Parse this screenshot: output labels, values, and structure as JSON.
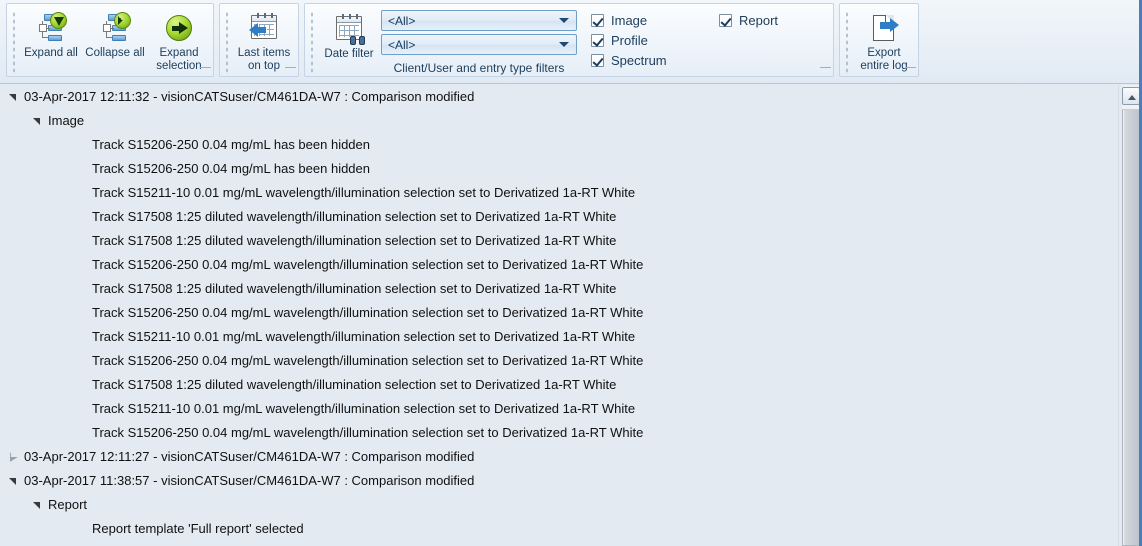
{
  "ribbon": {
    "groups": [
      {
        "name": "expand-collapse",
        "buttons": [
          {
            "label_line1": "Expand all",
            "label_line2": "",
            "icon": "expand-all-icon"
          },
          {
            "label_line1": "Collapse all",
            "label_line2": "",
            "icon": "collapse-all-icon"
          },
          {
            "label_line1": "Expand",
            "label_line2": "selection",
            "icon": "expand-selection-icon"
          }
        ]
      },
      {
        "name": "sorting",
        "buttons": [
          {
            "label_line1": "Last items",
            "label_line2": "on top",
            "icon": "last-items-on-top-icon"
          }
        ]
      },
      {
        "name": "date-filter",
        "buttons": [
          {
            "label_line1": "Date filter",
            "label_line2": "",
            "icon": "date-filter-icon"
          }
        ]
      }
    ],
    "filters": {
      "caption": "Client/User and entry type filters",
      "client_combo": {
        "value": "<All>",
        "arrow": "chevron-down-icon"
      },
      "user_combo": {
        "value": "<All>",
        "arrow": "chevron-down-icon"
      }
    },
    "entry_types": {
      "column1": [
        {
          "label": "Image",
          "checked": true
        },
        {
          "label": "Profile",
          "checked": true
        },
        {
          "label": "Spectrum",
          "checked": true
        }
      ],
      "column2": [
        {
          "label": "Report",
          "checked": true
        }
      ]
    },
    "export": {
      "label_line1": "Export",
      "label_line2": "entire log",
      "icon": "export-entire-log-icon"
    }
  },
  "tree": {
    "rows": [
      {
        "level": 0,
        "state": "expanded",
        "text": "03-Apr-2017 12:11:32 - visionCATSuser/CM461DA-W7 : Comparison modified"
      },
      {
        "level": 1,
        "state": "expanded",
        "text": "Image"
      },
      {
        "level": 2,
        "state": "leaf",
        "text": "Track S15206-250 0.04 mg/mL has been hidden"
      },
      {
        "level": 2,
        "state": "leaf",
        "text": "Track S15206-250 0.04 mg/mL has been hidden"
      },
      {
        "level": 2,
        "state": "leaf",
        "text": "Track S15211-10 0.01 mg/mL wavelength/illumination selection set to Derivatized 1a-RT White"
      },
      {
        "level": 2,
        "state": "leaf",
        "text": "Track S17508 1:25 diluted wavelength/illumination selection set to Derivatized 1a-RT White"
      },
      {
        "level": 2,
        "state": "leaf",
        "text": "Track S17508 1:25 diluted wavelength/illumination selection set to Derivatized 1a-RT White"
      },
      {
        "level": 2,
        "state": "leaf",
        "text": "Track S15206-250 0.04 mg/mL wavelength/illumination selection set to Derivatized 1a-RT White"
      },
      {
        "level": 2,
        "state": "leaf",
        "text": "Track S17508 1:25 diluted wavelength/illumination selection set to Derivatized 1a-RT White"
      },
      {
        "level": 2,
        "state": "leaf",
        "text": "Track S15206-250 0.04 mg/mL wavelength/illumination selection set to Derivatized 1a-RT White"
      },
      {
        "level": 2,
        "state": "leaf",
        "text": "Track S15211-10 0.01 mg/mL wavelength/illumination selection set to Derivatized 1a-RT White"
      },
      {
        "level": 2,
        "state": "leaf",
        "text": "Track S15206-250 0.04 mg/mL wavelength/illumination selection set to Derivatized 1a-RT White"
      },
      {
        "level": 2,
        "state": "leaf",
        "text": "Track S17508 1:25 diluted wavelength/illumination selection set to Derivatized 1a-RT White"
      },
      {
        "level": 2,
        "state": "leaf",
        "text": "Track S15211-10 0.01 mg/mL wavelength/illumination selection set to Derivatized 1a-RT White"
      },
      {
        "level": 2,
        "state": "leaf",
        "text": "Track S15206-250 0.04 mg/mL wavelength/illumination selection set to Derivatized 1a-RT White"
      },
      {
        "level": 0,
        "state": "collapsed",
        "text": "03-Apr-2017 12:11:27 - visionCATSuser/CM461DA-W7 : Comparison modified"
      },
      {
        "level": 0,
        "state": "expanded",
        "text": "03-Apr-2017 11:38:57 - visionCATSuser/CM461DA-W7 : Comparison modified"
      },
      {
        "level": 1,
        "state": "expanded",
        "text": "Report"
      },
      {
        "level": 2,
        "state": "leaf",
        "text": "Report template 'Full report' selected"
      }
    ]
  },
  "scrollbar": {
    "up_arrow": "scroll-up-icon",
    "thumb": "scroll-thumb"
  },
  "colors": {
    "content_background": "#e3eaf2",
    "ribbon_background": "#eaf0f7",
    "accent_blue": "#4a7ebb",
    "text": "#111111",
    "label_text": "#1c3d5c"
  }
}
